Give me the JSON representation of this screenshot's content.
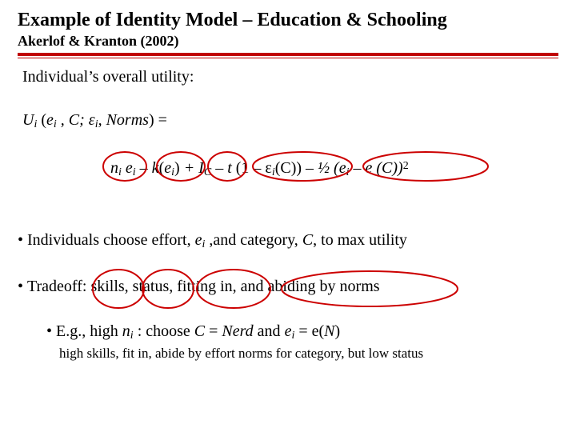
{
  "header": {
    "title": "Example of Identity Model – Education & Schooling",
    "subtitle": "Akerlof & Kranton (2002)"
  },
  "intro": "Individual’s overall utility:",
  "utility_fn": {
    "lhs_U": "U",
    "lhs_i": "i",
    "lhs_open": " (",
    "lhs_e": "e",
    "lhs_ei_i": "i",
    "lhs_mid1": " , C; ε",
    "lhs_eps_i": "i",
    "lhs_mid2": ", Norms",
    "lhs_close": ") ="
  },
  "formula": {
    "t1a": "n",
    "t1b": "i",
    "t1c": " e",
    "t1d": "i",
    "t2a": " – k",
    "t2b": "(",
    "t2c": "e",
    "t2d": "i",
    "t2e": ")",
    "t3a": " + I",
    "t3b": "C",
    "t4a": " – t ",
    "t4b": "(1 – ε",
    "t4c": "i",
    "t4d": "(C))",
    "t5a": " – ½ (",
    "t5b": "e",
    "t5c": "i",
    "t5d": " – e (C))",
    "t5e": "2"
  },
  "bullets": {
    "b1_pre": "Individuals choose effort, ",
    "b1_e": "e",
    "b1_i": "i",
    "b1_mid": " ,and category, ",
    "b1_C": "C",
    "b1_post": ", to max utility",
    "b2": "Tradeoff:  skills, status, fitting in, and abiding by norms",
    "sub_pre": "E.g., high ",
    "sub_n": "n",
    "sub_i": "i",
    "sub_mid1": " : choose ",
    "sub_C": "C",
    "sub_eq1": " = ",
    "sub_Nerd": "Nerd",
    "sub_and": " and ",
    "sub_e": "e",
    "sub_ei": "i",
    "sub_eq2": "  = e(",
    "sub_N": "N",
    "sub_close": ")",
    "note": "high skills, fit in, abide by effort norms for category, but low status"
  }
}
